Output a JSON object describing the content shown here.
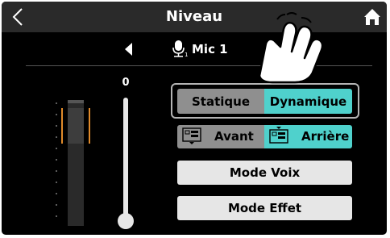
{
  "header": {
    "title": "Niveau",
    "back_icon": "chevron-left-icon",
    "home_icon": "home-icon"
  },
  "input_selector": {
    "label": "Mic 1",
    "icon": "mic-icon",
    "prev_icon": "triangle-left-icon"
  },
  "fader": {
    "value": "0",
    "level_fraction": 0.0
  },
  "buttons": {
    "static": "Statique",
    "dynamic": "Dynamique",
    "front": "Avant",
    "rear": "Arrière",
    "voice_mode": "Mode Voix",
    "effect_mode": "Mode Effet"
  },
  "colors": {
    "active": "#4fd1cc",
    "inactive": "#8f8f8f",
    "meter_peak": "#e08a2a"
  }
}
